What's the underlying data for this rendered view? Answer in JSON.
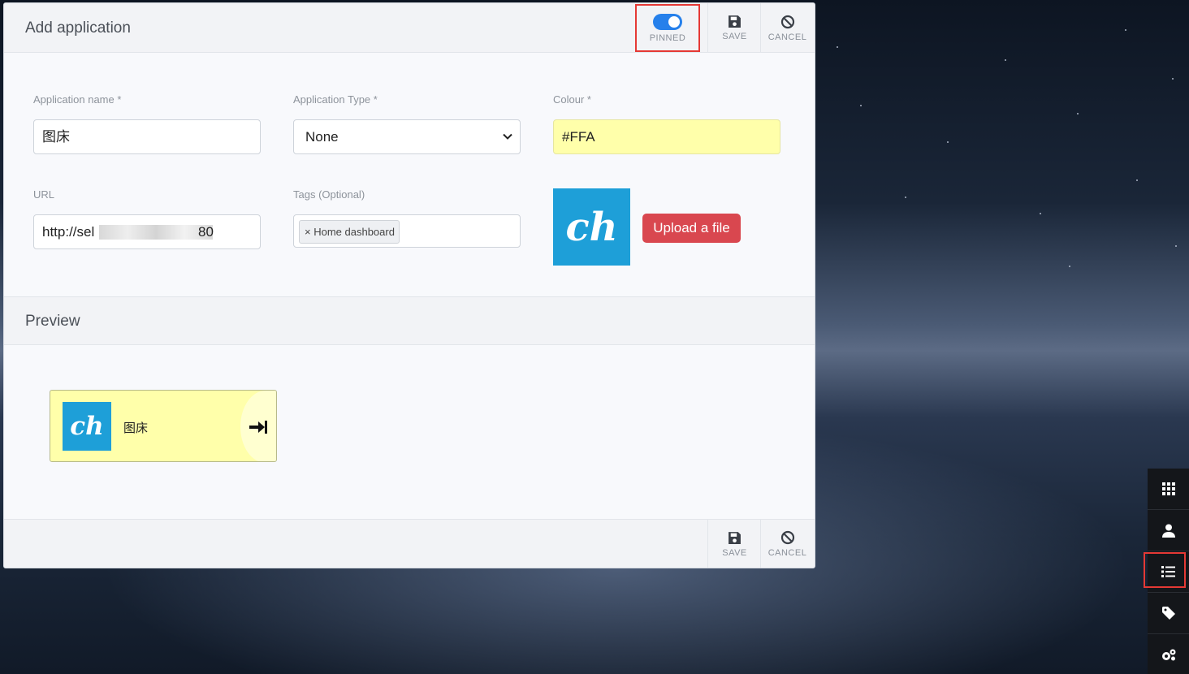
{
  "modal": {
    "title": "Add application",
    "pinned_label": "PINNED",
    "pinned_on": true,
    "save_label": "SAVE",
    "cancel_label": "CANCEL"
  },
  "form": {
    "app_name_label": "Application name *",
    "app_name_value": "图床",
    "app_type_label": "Application Type *",
    "app_type_value": "None",
    "colour_label": "Colour *",
    "colour_value": "#FFA",
    "url_label": "URL",
    "url_prefix": "http://sel",
    "url_suffix": "80",
    "tags_label": "Tags (Optional)",
    "tags": [
      "Home dashboard"
    ],
    "tag_remove_glyph": "×",
    "icon_text": "ch",
    "upload_label": "Upload a file"
  },
  "preview": {
    "title": "Preview",
    "tile_name": "图床",
    "tile_icon_text": "ch"
  },
  "sidebar": {
    "items": [
      {
        "icon": "grid-icon"
      },
      {
        "icon": "user-icon"
      },
      {
        "icon": "list-icon"
      },
      {
        "icon": "tag-icon"
      },
      {
        "icon": "cogs-icon"
      }
    ]
  },
  "colors": {
    "accent": "#2680eb",
    "danger": "#d9474f",
    "tile_bg": "#ffffaa",
    "logo_bg": "#1e9fd8",
    "highlight": "#e53935"
  }
}
